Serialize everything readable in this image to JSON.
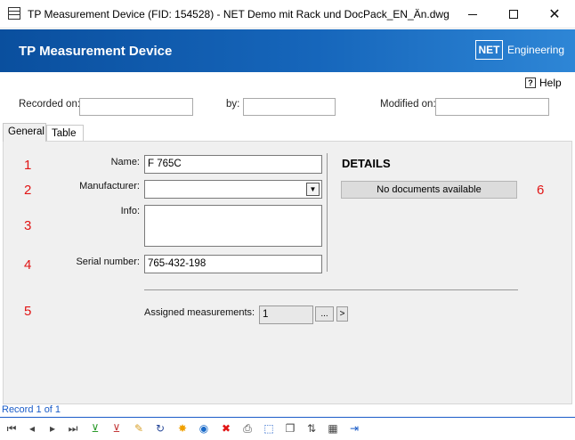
{
  "window": {
    "title": "TP Measurement Device (FID: 154528) - NET Demo mit Rack und DocPack_EN_Än.dwg"
  },
  "banner": {
    "title": "TP Measurement Device",
    "logo_text": "NET",
    "logo_sub": "Engineering",
    "colors": {
      "start": "#0a4f9e",
      "end": "#2e86d6"
    }
  },
  "help": {
    "label": "Help",
    "icon_glyph": "?"
  },
  "meta": {
    "recorded_on_label": "Recorded on:",
    "recorded_on_value": "",
    "by_label": "by:",
    "by_value": "",
    "modified_on_label": "Modified on:",
    "modified_on_value": ""
  },
  "tabs": [
    {
      "label": "General",
      "active": true
    },
    {
      "label": "Table",
      "active": false
    }
  ],
  "form": {
    "name_label": "Name:",
    "name_value": "F 765C",
    "manufacturer_label": "Manufacturer:",
    "manufacturer_value": "",
    "info_label": "Info:",
    "info_value": "",
    "serial_label": "Serial number:",
    "serial_value": "765-432-198",
    "assigned_label": "Assigned measurements:",
    "assigned_value": "1",
    "ellipsis_label": "...",
    "next_label": ">"
  },
  "annotations": [
    "1",
    "2",
    "3",
    "4",
    "5",
    "6"
  ],
  "details": {
    "title": "DETAILS",
    "no_docs": "No documents available"
  },
  "status": {
    "record": "Record 1 of 1"
  },
  "toolbar_icons": [
    "first-record-icon",
    "previous-record-icon",
    "next-record-icon",
    "last-record-icon",
    "filter-add-icon",
    "filter-remove-icon",
    "edit-icon",
    "refresh-icon",
    "highlight-icon",
    "zoom-to-icon",
    "delete-icon",
    "print-icon",
    "select-icon",
    "copy-icon",
    "sort-icon",
    "table-edit-icon",
    "exit-icon"
  ],
  "accent_color": "#1a5cc8",
  "annotation_color": "#e11414"
}
